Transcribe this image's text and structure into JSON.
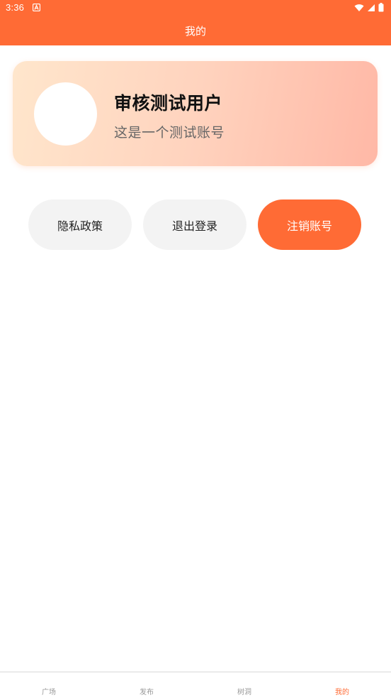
{
  "status_bar": {
    "time": "3:36"
  },
  "header": {
    "title": "我的"
  },
  "profile": {
    "username": "审核测试用户",
    "description": "这是一个测试账号"
  },
  "actions": {
    "privacy_label": "隐私政策",
    "logout_label": "退出登录",
    "cancel_account_label": "注销账号"
  },
  "bottom_nav": {
    "items": [
      {
        "label": "广场"
      },
      {
        "label": "发布"
      },
      {
        "label": "树洞"
      },
      {
        "label": "我的"
      }
    ],
    "active_index": 3
  },
  "colors": {
    "accent": "#ff6b35",
    "button_gray": "#f3f3f3",
    "card_gradient_start": "#ffe6cc",
    "card_gradient_end": "#ffb8a6"
  }
}
